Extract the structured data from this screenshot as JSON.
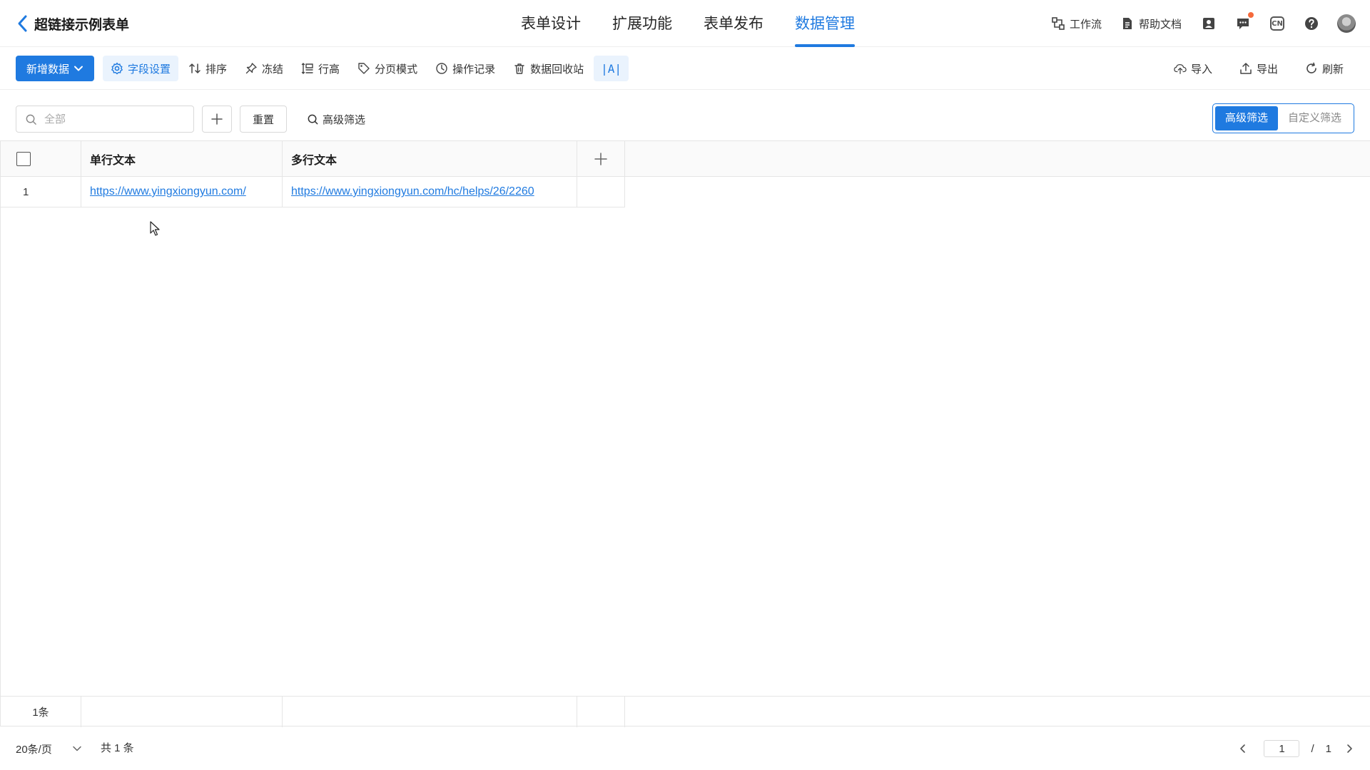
{
  "header": {
    "title": "超链接示例表单",
    "tabs": [
      {
        "label": "表单设计"
      },
      {
        "label": "扩展功能"
      },
      {
        "label": "表单发布"
      },
      {
        "label": "数据管理"
      }
    ],
    "active_tab": "数据管理",
    "workflow_label": "工作流",
    "help_label": "帮助文档",
    "lang_badge": "CN"
  },
  "toolbar": {
    "add_label": "新增数据",
    "tools": [
      {
        "label": "字段设置",
        "icon": "gear-icon"
      },
      {
        "label": "排序",
        "icon": "sort-icon"
      },
      {
        "label": "冻结",
        "icon": "pin-icon"
      },
      {
        "label": "行高",
        "icon": "row-height-icon"
      },
      {
        "label": "分页模式",
        "icon": "tag-icon"
      },
      {
        "label": "操作记录",
        "icon": "clock-icon"
      },
      {
        "label": "数据回收站",
        "icon": "trash-icon"
      }
    ],
    "text_mode_label": "|A|",
    "import_label": "导入",
    "export_label": "导出",
    "refresh_label": "刷新"
  },
  "filters": {
    "search_placeholder": "全部",
    "reset_label": "重置",
    "advanced_label": "高级筛选",
    "segments": [
      "高级筛选",
      "自定义筛选"
    ],
    "active_segment": "高级筛选"
  },
  "table": {
    "columns": [
      "单行文本",
      "多行文本"
    ],
    "rows": [
      {
        "index": "1",
        "single_text": "https://www.yingxiongyun.com/",
        "multi_text": "https://www.yingxiongyun.com/hc/helps/26/2260"
      }
    ],
    "footer_count": "1条"
  },
  "pagination": {
    "page_size": "20条/页",
    "total": "共 1 条",
    "current_page": "1",
    "separator": "/",
    "total_pages": "1"
  },
  "colors": {
    "accent": "#1f7ae0",
    "notification_dot": "#f56a3c"
  }
}
